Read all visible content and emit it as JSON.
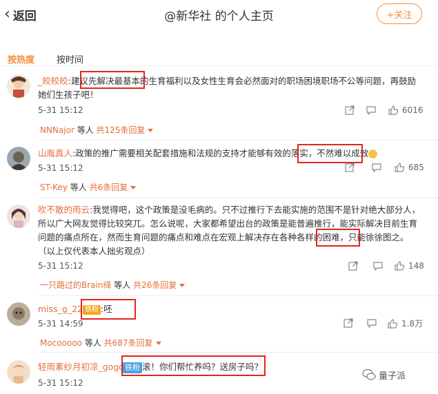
{
  "header": {
    "back_icon": "chevron-left-icon",
    "back_label": "返回",
    "title": "@新华社 的个人主页",
    "follow_label": "+关注"
  },
  "tabs": [
    {
      "label": "按热度",
      "active": true
    },
    {
      "label": "按时间",
      "active": false
    }
  ],
  "comments": [
    {
      "user": "_皎皎皎",
      "text_a": ":建议",
      "text_b": "先解决最基本的",
      "text_c": "生育福利以及女性生育会必然面对的职场困境职场不公等问题，再鼓励她们生孩子吧！",
      "time": "5-31 15:12",
      "likes": "6016",
      "reply_user": "NNNajor",
      "reply_mid": " 等人 ",
      "reply_count": "共125条回复"
    },
    {
      "user": "山胤真人",
      "text_a": ":政策的推广需要相关配套措施和法规的支持才能够有效的落实，",
      "text_b": "不然难以成效",
      "text_c": "",
      "time": "5-31 15:12",
      "likes": "685",
      "reply_user": "ST-Key",
      "reply_mid": " 等人 ",
      "reply_count": "共6条回复"
    },
    {
      "user": "吹不散的雨云",
      "text_a": ":我觉得吧，这个政策是没毛病的。只不过推行下去能实施的范围不是针对绝大部分人，所以广大网友觉得比较突兀。怎么说呢，大家都希望出台的政策是能普遍推行，能实际解决目前生育问题的痛点所在，然而生育问题的痛点和难点在宏观上解决存在各种各样的困难，只能",
      "text_b": "徐徐图之",
      "text_c": "。（以上仅代表本人拙劣观点）",
      "time": "5-31 15:12",
      "likes": "148",
      "reply_user": "一只路过的Brain绎",
      "reply_mid": " 等人 ",
      "reply_count": "共26条回复"
    },
    {
      "user": "miss_g_22",
      "badge": "铁粉",
      "text_a": ":呸",
      "time": "5-31 14:59",
      "likes": "1.8万",
      "reply_user": "Mocooooo",
      "reply_mid": " 等人 ",
      "reply_count": "共687条回复"
    },
    {
      "user": "轻雨素纱月初凉_gogo",
      "badge": "铁粉",
      "text_a": "滚！你们帮忙养吗？送房子吗？",
      "time": "5-31 15:12"
    }
  ],
  "watermark": "量子派",
  "colors": {
    "accent": "#f28e3a",
    "username": "#e56e3a",
    "highlight_box": "#e3241c"
  }
}
